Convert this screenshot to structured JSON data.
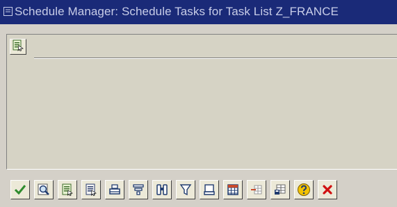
{
  "window": {
    "title": "Schedule Manager: Schedule Tasks for Task List Z_FRANCE"
  },
  "app_toolbar": {
    "buttons": [
      {
        "icon": "execute-list-icon"
      }
    ]
  },
  "bottom_toolbar": {
    "buttons": [
      {
        "icon": "check-icon",
        "color": "#2e8b2e"
      },
      {
        "icon": "display-detail-icon"
      },
      {
        "icon": "list-details-icon"
      },
      {
        "icon": "document-list-icon"
      },
      {
        "icon": "print-icon"
      },
      {
        "icon": "sort-icon"
      },
      {
        "icon": "find-icon"
      },
      {
        "icon": "filter-icon"
      },
      {
        "icon": "printer-setup-icon"
      },
      {
        "icon": "table-grid-icon"
      },
      {
        "icon": "insert-row-icon"
      },
      {
        "icon": "layout-save-icon"
      },
      {
        "icon": "help-icon",
        "color": "#e0b000"
      },
      {
        "icon": "cancel-icon",
        "color": "#d01010"
      }
    ]
  }
}
